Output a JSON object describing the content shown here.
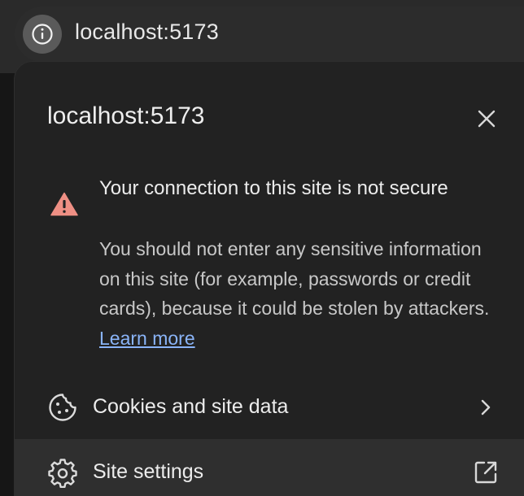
{
  "omnibox": {
    "url": "localhost:5173",
    "site_info_icon": "info-icon"
  },
  "popup": {
    "title": "localhost:5173",
    "close_icon": "close-icon",
    "security": {
      "icon": "warning-triangle-icon",
      "heading": "Your connection to this site is not secure",
      "body": "You should not enter any sensitive information on this site (for example, passwords or credit cards), because it could be stolen by attackers.",
      "learn_more": "Learn more"
    },
    "rows": {
      "cookies": {
        "label": "Cookies and site data",
        "icon": "cookie-icon",
        "trailing_icon": "chevron-right-icon"
      },
      "settings": {
        "label": "Site settings",
        "icon": "gear-icon",
        "trailing_icon": "open-external-icon"
      }
    }
  },
  "colors": {
    "background": "#1e1e1e",
    "popup_background": "#222222",
    "text_primary": "#ececec",
    "text_secondary": "#c8c8c8",
    "link": "#8ab4f8",
    "warning": "#ee8f84",
    "hover_row": "#2f2f2f"
  }
}
